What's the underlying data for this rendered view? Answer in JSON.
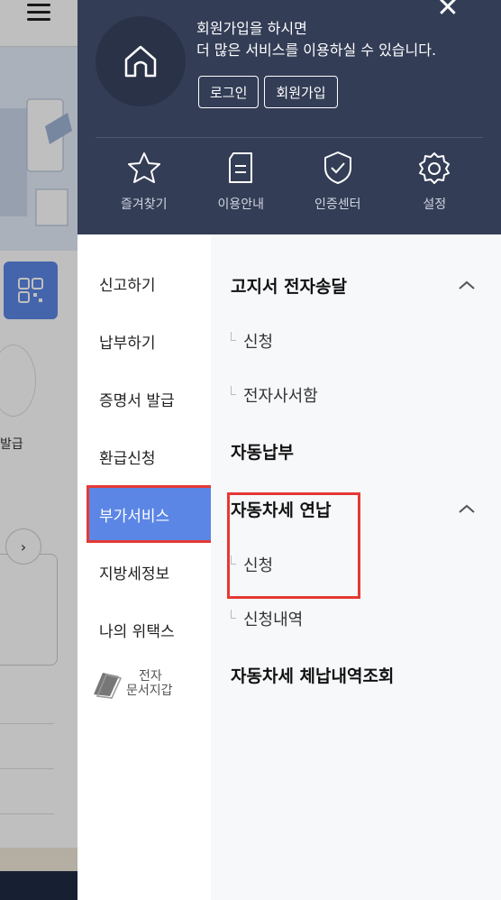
{
  "background_page": {
    "issue_label_fragment": "발급",
    "arrow_glyph": "›"
  },
  "header": {
    "close_glyph": "✕",
    "join_prompt_line1": "회원가입을 하시면",
    "join_prompt_line2": "더 많은 서비스를 이용하실 수 있습니다.",
    "login_label": "로그인",
    "signup_label": "회원가입",
    "quick_menu": [
      {
        "label": "즐겨찾기",
        "icon": "star-icon"
      },
      {
        "label": "이용안내",
        "icon": "guide-document-icon"
      },
      {
        "label": "인증센터",
        "icon": "shield-check-icon"
      },
      {
        "label": "설정",
        "icon": "gear-icon"
      }
    ]
  },
  "left_nav": {
    "items": [
      {
        "label": "신고하기"
      },
      {
        "label": "납부하기"
      },
      {
        "label": "증명서 발급"
      },
      {
        "label": "환급신청"
      },
      {
        "label": "부가서비스",
        "active": true
      },
      {
        "label": "지방세정보"
      },
      {
        "label": "나의 위택스"
      }
    ],
    "wallet_line1": "전자",
    "wallet_line2": "문서지갑"
  },
  "sub_menu": {
    "section1_title": "고지서 전자송달",
    "section1_items": [
      "신청",
      "전자사서함"
    ],
    "section2_title": "자동납부",
    "section3_title": "자동차세 연납",
    "section3_items": [
      "신청",
      "신청내역"
    ],
    "section4_title": "자동차세 체납내역조회"
  },
  "colors": {
    "header_bg": "#333d56",
    "active_nav": "#5b86e5",
    "highlight_red": "#e53935"
  }
}
